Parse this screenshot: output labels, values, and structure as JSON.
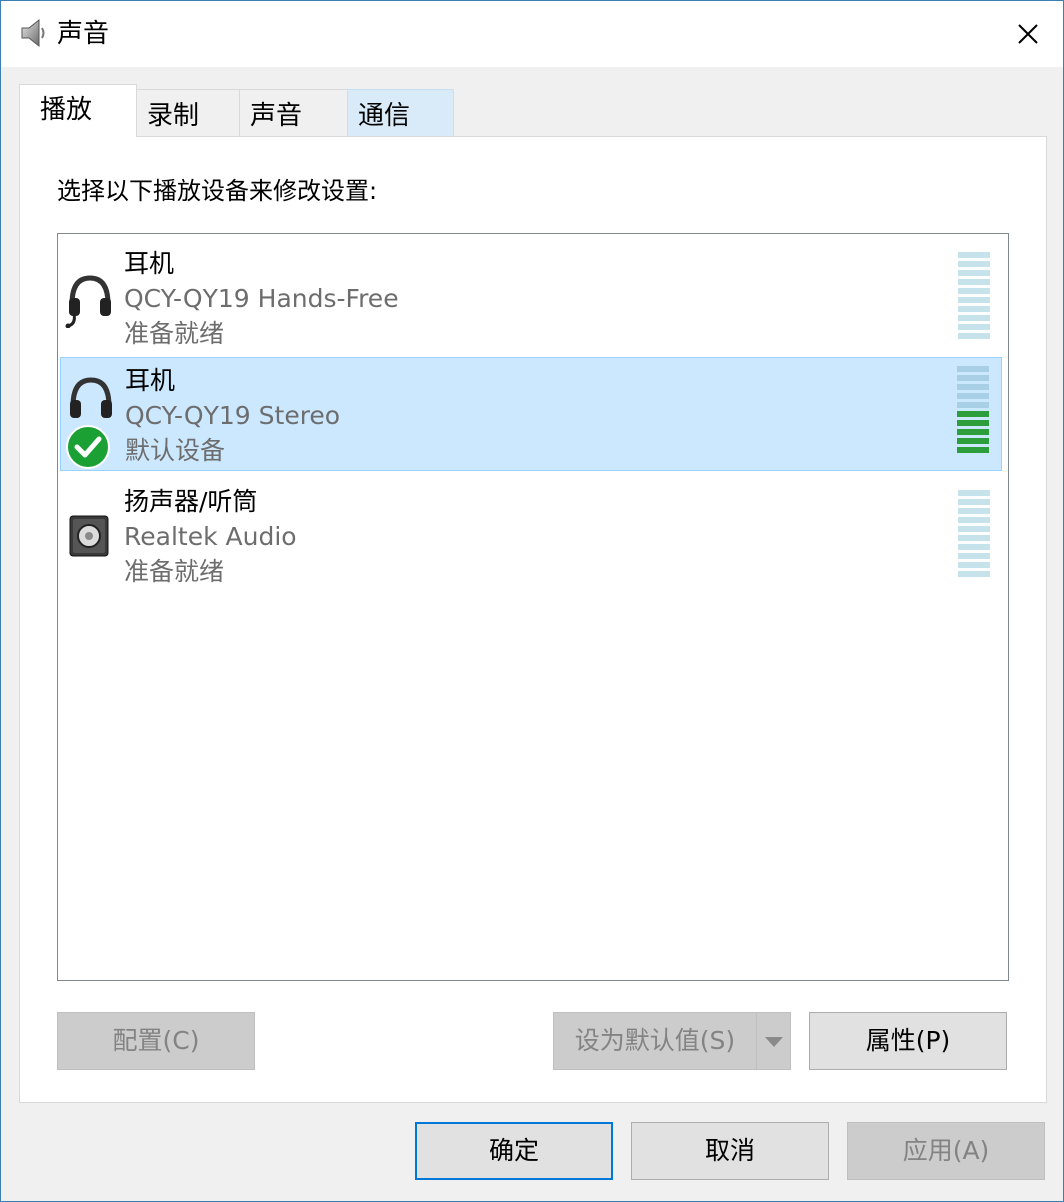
{
  "window": {
    "title": "声音",
    "title_icon": "speaker-icon",
    "close_icon": "close-icon"
  },
  "tabs": [
    {
      "label": "播放",
      "active": true
    },
    {
      "label": "录制",
      "active": false
    },
    {
      "label": "声音",
      "active": false
    },
    {
      "label": "通信",
      "active": false,
      "hover": true
    }
  ],
  "instruction": "选择以下播放设备来修改设置:",
  "devices": [
    {
      "name": "耳机",
      "description": "QCY-QY19 Hands-Free",
      "status": "准备就绪",
      "icon": "headset-icon",
      "selected": false,
      "default": false,
      "level_bars_lit": 0
    },
    {
      "name": "耳机",
      "description": "QCY-QY19 Stereo",
      "status": "默认设备",
      "icon": "headset-icon",
      "selected": true,
      "default": true,
      "level_bars_lit": 5
    },
    {
      "name": "扬声器/听筒",
      "description": "Realtek Audio",
      "status": "准备就绪",
      "icon": "speaker-box-icon",
      "selected": false,
      "default": false,
      "level_bars_lit": 0
    }
  ],
  "buttons": {
    "configure": "配置(C)",
    "set_default": "设为默认值(S)",
    "properties": "属性(P)",
    "ok": "确定",
    "cancel": "取消",
    "apply": "应用(A)"
  },
  "colors": {
    "accent": "#0078d7",
    "selection_bg": "#cce8ff",
    "meter_idle": "#c6e2ea",
    "meter_active": "#2e9d3b",
    "default_check": "#1aa033"
  }
}
